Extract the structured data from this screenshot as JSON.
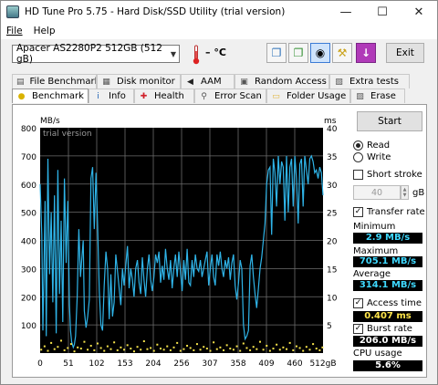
{
  "window": {
    "title": "HD Tune Pro 5.75 - Hard Disk/SSD Utility (trial version)"
  },
  "menu": {
    "file": "File",
    "help": "Help"
  },
  "toolbar": {
    "drive": "Apacer AS2280P2 512GB (512 gB)",
    "temperature": "– °C",
    "exit": "Exit"
  },
  "tabs_back": [
    {
      "label": "File Benchmark",
      "icon": "file-benchmark-icon"
    },
    {
      "label": "Disk monitor",
      "icon": "disk-monitor-icon"
    },
    {
      "label": "AAM",
      "icon": "speaker-icon"
    },
    {
      "label": "Random Access",
      "icon": "random-access-icon"
    },
    {
      "label": "Extra tests",
      "icon": "extra-tests-icon"
    }
  ],
  "tabs_front": [
    {
      "label": "Benchmark",
      "icon": "benchmark-icon"
    },
    {
      "label": "Info",
      "icon": "info-icon"
    },
    {
      "label": "Health",
      "icon": "health-cross-icon"
    },
    {
      "label": "Error Scan",
      "icon": "magnifier-icon"
    },
    {
      "label": "Folder Usage",
      "icon": "folder-icon"
    },
    {
      "label": "Erase",
      "icon": "erase-icon"
    }
  ],
  "side": {
    "start": "Start",
    "read": "Read",
    "write": "Write",
    "short_stroke": "Short stroke",
    "stroke_value": "40",
    "stroke_unit": "gB",
    "transfer_rate": "Transfer rate",
    "minimum_label": "Minimum",
    "minimum_value": "2.9 MB/s",
    "maximum_label": "Maximum",
    "maximum_value": "705.1 MB/s",
    "average_label": "Average",
    "average_value": "314.1 MB/s",
    "access_time_label": "Access time",
    "access_time_value": "0.407 ms",
    "burst_rate_label": "Burst rate",
    "burst_rate_value": "206.0 MB/s",
    "cpu_usage_label": "CPU usage",
    "cpu_usage_value": "5.6%"
  },
  "chart_data": {
    "type": "line",
    "watermark": "trial version",
    "y_left_unit": "MB/s",
    "y_right_unit": "ms",
    "x_unit": "gB",
    "ylim_left": [
      0,
      800
    ],
    "ylim_right": [
      0,
      40
    ],
    "xlim": [
      0,
      512
    ],
    "y_left_ticks": [
      "800",
      "700",
      "600",
      "500",
      "400",
      "300",
      "200",
      "100"
    ],
    "y_right_ticks": [
      "40",
      "35",
      "30",
      "25",
      "20",
      "15",
      "10",
      "5"
    ],
    "x_ticks": [
      "0",
      "51",
      "102",
      "153",
      "204",
      "256",
      "307",
      "358",
      "409",
      "460",
      "512gB"
    ],
    "grid": true,
    "series": [
      {
        "color": "#2fb4e8",
        "x": [
          0,
          3,
          5,
          7,
          9,
          11,
          14,
          17,
          20,
          23,
          26,
          29,
          32,
          35,
          38,
          41,
          44,
          47,
          50,
          53,
          55,
          57,
          60,
          62,
          64,
          67,
          70,
          73,
          76,
          78,
          80,
          83,
          86,
          89,
          92,
          95,
          98,
          101,
          104,
          107,
          110,
          113,
          116,
          119,
          122,
          125,
          128,
          131,
          134,
          137,
          140,
          143,
          146,
          149,
          152,
          155,
          158,
          161,
          164,
          167,
          170,
          173,
          176,
          179,
          182,
          185,
          188,
          191,
          194,
          197,
          200,
          203,
          206,
          209,
          212,
          215,
          218,
          221,
          224,
          227,
          230,
          233,
          236,
          239,
          242,
          245,
          248,
          251,
          254,
          257,
          260,
          263,
          266,
          269,
          272,
          275,
          278,
          281,
          284,
          287,
          290,
          293,
          296,
          299,
          302,
          305,
          308,
          311,
          314,
          317,
          320,
          323,
          326,
          329,
          332,
          335,
          338,
          341,
          344,
          347,
          350,
          353,
          356,
          359,
          362,
          365,
          368,
          371,
          374,
          377,
          380,
          383,
          386,
          389,
          392,
          395,
          398,
          401,
          404,
          407,
          410,
          413,
          416,
          419,
          422,
          425,
          428,
          431,
          434,
          437,
          440,
          443,
          446,
          449,
          452,
          455,
          458,
          461,
          464,
          467,
          470,
          473,
          476,
          479,
          482,
          485,
          488,
          491,
          494,
          497,
          500,
          503,
          506,
          509,
          512
        ],
        "y": [
          600,
          420,
          80,
          300,
          540,
          60,
          690,
          280,
          500,
          180,
          560,
          70,
          650,
          210,
          470,
          110,
          620,
          320,
          540,
          170,
          80,
          40,
          20,
          30,
          60,
          200,
          440,
          270,
          350,
          400,
          150,
          90,
          130,
          190,
          620,
          660,
          440,
          640,
          450,
          220,
          100,
          80,
          240,
          360,
          300,
          120,
          280,
          130,
          180,
          350,
          290,
          230,
          170,
          300,
          240,
          310,
          380,
          230,
          300,
          260,
          200,
          300,
          330,
          250,
          210,
          340,
          260,
          200,
          300,
          350,
          260,
          220,
          270,
          350,
          320,
          360,
          250,
          310,
          260,
          370,
          300,
          260,
          330,
          230,
          300,
          350,
          270,
          360,
          290,
          220,
          330,
          260,
          370,
          250,
          240,
          330,
          270,
          350,
          300,
          290,
          330,
          270,
          300,
          330,
          360,
          240,
          300,
          350,
          270,
          240,
          350,
          310,
          360,
          300,
          270,
          330,
          300,
          340,
          260,
          320,
          350,
          240,
          190,
          250,
          330,
          300,
          100,
          50,
          60,
          80,
          310,
          350,
          270,
          210,
          160,
          230,
          300,
          340,
          400,
          460,
          600,
          650,
          660,
          420,
          690,
          640,
          520,
          700,
          600,
          680,
          660,
          470,
          700,
          500,
          660,
          690,
          520,
          700,
          620,
          460,
          670,
          690,
          520,
          700,
          650,
          600,
          690,
          700,
          680,
          640,
          650,
          620,
          660,
          640,
          560
        ]
      },
      {
        "color": "#f5e24a",
        "description_type": "scatter",
        "x": [
          2,
          8,
          14,
          20,
          26,
          32,
          38,
          44,
          50,
          56,
          62,
          68,
          74,
          80,
          86,
          92,
          98,
          104,
          110,
          116,
          122,
          128,
          134,
          140,
          146,
          152,
          158,
          164,
          170,
          176,
          182,
          188,
          194,
          200,
          206,
          212,
          218,
          224,
          230,
          236,
          242,
          248,
          254,
          260,
          266,
          272,
          278,
          284,
          290,
          296,
          302,
          308,
          314,
          320,
          326,
          332,
          338,
          344,
          350,
          356,
          362,
          368,
          374,
          380,
          386,
          392,
          398,
          404,
          410,
          416,
          422,
          428,
          434,
          440,
          446,
          452,
          458,
          464,
          470,
          476,
          482,
          488,
          494,
          500,
          506,
          511
        ],
        "y": [
          0.6,
          1.2,
          0.4,
          1.8,
          0.7,
          1.1,
          2.2,
          0.5,
          0.9,
          1.6,
          0.3,
          1.0,
          0.8,
          2.0,
          0.6,
          1.3,
          0.5,
          1.7,
          0.9,
          0.4,
          1.2,
          0.7,
          1.9,
          0.5,
          1.0,
          0.6,
          1.4,
          0.8,
          0.3,
          1.1,
          0.6,
          2.1,
          0.7,
          0.9,
          0.4,
          1.5,
          0.8,
          0.6,
          1.2,
          0.5,
          1.0,
          1.8,
          0.4,
          0.7,
          1.3,
          0.9,
          0.5,
          1.6,
          0.6,
          1.1,
          0.8,
          0.4,
          1.9,
          0.7,
          1.0,
          0.5,
          1.4,
          0.8,
          0.6,
          1.2,
          0.4,
          1.7,
          0.9,
          0.5,
          1.1,
          0.7,
          2.0,
          0.6,
          1.3,
          0.4,
          0.8,
          1.5,
          0.6,
          1.0,
          0.7,
          1.8,
          0.5,
          1.2,
          0.9,
          0.4,
          1.1,
          0.6,
          1.6,
          0.8,
          0.5,
          1.0
        ]
      }
    ]
  }
}
